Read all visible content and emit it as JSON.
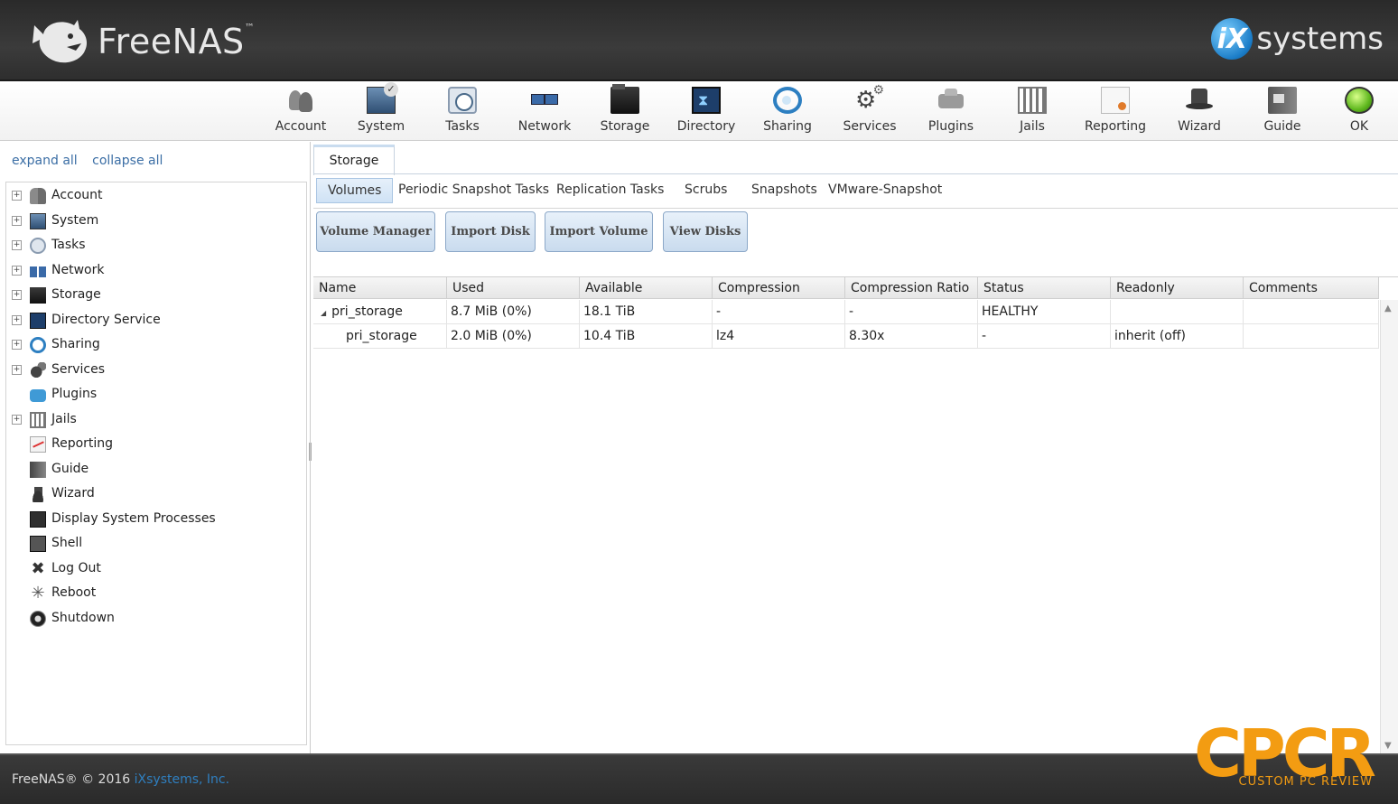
{
  "header": {
    "brand": "FreeNAS",
    "brand_tm": "™",
    "vendor_mark": "iX",
    "vendor_text": "systems"
  },
  "toolbar": {
    "items": [
      {
        "label": "Account",
        "icon": "account-icon"
      },
      {
        "label": "System",
        "icon": "system-icon"
      },
      {
        "label": "Tasks",
        "icon": "tasks-icon"
      },
      {
        "label": "Network",
        "icon": "network-icon"
      },
      {
        "label": "Storage",
        "icon": "storage-icon"
      },
      {
        "label": "Directory",
        "icon": "directory-icon"
      },
      {
        "label": "Sharing",
        "icon": "sharing-icon"
      },
      {
        "label": "Services",
        "icon": "services-icon"
      },
      {
        "label": "Plugins",
        "icon": "plugins-icon"
      },
      {
        "label": "Jails",
        "icon": "jails-icon"
      },
      {
        "label": "Reporting",
        "icon": "reporting-icon"
      },
      {
        "label": "Wizard",
        "icon": "wizard-icon"
      },
      {
        "label": "Guide",
        "icon": "guide-icon"
      },
      {
        "label": "OK",
        "icon": "status-ok-icon"
      }
    ]
  },
  "sidebar": {
    "expand_all": "expand all",
    "collapse_all": "collapse all",
    "items": [
      {
        "label": "Account",
        "expandable": true
      },
      {
        "label": "System",
        "expandable": true
      },
      {
        "label": "Tasks",
        "expandable": true
      },
      {
        "label": "Network",
        "expandable": true
      },
      {
        "label": "Storage",
        "expandable": true
      },
      {
        "label": "Directory Service",
        "expandable": true
      },
      {
        "label": "Sharing",
        "expandable": true
      },
      {
        "label": "Services",
        "expandable": true
      },
      {
        "label": "Plugins",
        "expandable": false
      },
      {
        "label": "Jails",
        "expandable": true
      },
      {
        "label": "Reporting",
        "expandable": false
      },
      {
        "label": "Guide",
        "expandable": false
      },
      {
        "label": "Wizard",
        "expandable": false
      },
      {
        "label": "Display System Processes",
        "expandable": false
      },
      {
        "label": "Shell",
        "expandable": false
      },
      {
        "label": "Log Out",
        "expandable": false
      },
      {
        "label": "Reboot",
        "expandable": false
      },
      {
        "label": "Shutdown",
        "expandable": false
      }
    ]
  },
  "main": {
    "tab": "Storage",
    "subtabs": [
      "Volumes",
      "Periodic Snapshot Tasks",
      "Replication Tasks",
      "Scrubs",
      "Snapshots",
      "VMware-Snapshot"
    ],
    "buttons": [
      "Volume Manager",
      "Import Disk",
      "Import Volume",
      "View Disks"
    ],
    "grid": {
      "columns": [
        "Name",
        "Used",
        "Available",
        "Compression",
        "Compression Ratio",
        "Status",
        "Readonly",
        "Comments"
      ],
      "rows": [
        {
          "expander": "◢",
          "name": "pri_storage",
          "used": "8.7 MiB (0%)",
          "available": "18.1 TiB",
          "compression": "-",
          "ratio": "-",
          "status": "HEALTHY",
          "readonly": "",
          "comments": ""
        },
        {
          "expander": "",
          "name": "pri_storage",
          "used": "2.0 MiB (0%)",
          "available": "10.4 TiB",
          "compression": "lz4",
          "ratio": "8.30x",
          "status": "-",
          "readonly": "inherit (off)",
          "comments": ""
        }
      ]
    }
  },
  "footer": {
    "copyright": "FreeNAS® © 2016",
    "company": "iXsystems, Inc."
  },
  "watermark": {
    "logo": "CPCR",
    "tagline": "CUSTOM PC REVIEW"
  },
  "colors": {
    "link": "#3b6ea5",
    "header_bg": "#2e2e2e",
    "accent": "#2f7fc0",
    "watermark": "#f39c12"
  }
}
